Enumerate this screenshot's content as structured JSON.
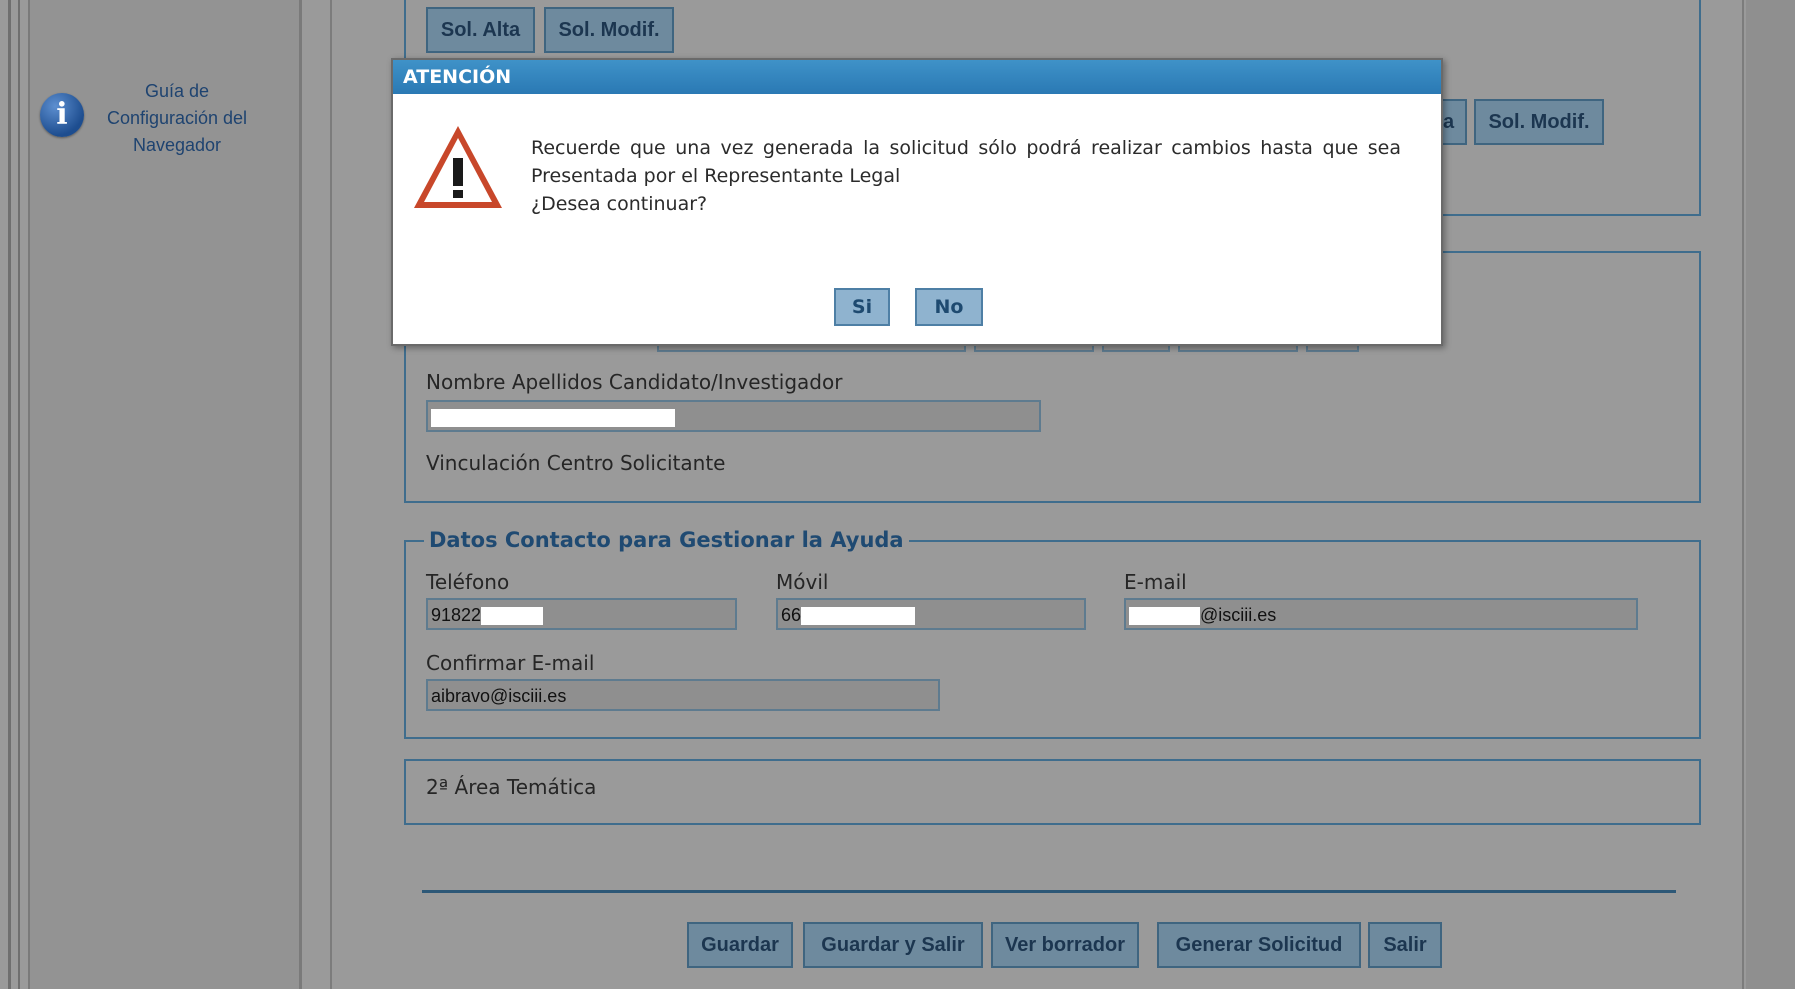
{
  "sidebar": {
    "guide_line1": "Guía de",
    "guide_line2": "Configuración del",
    "guide_line3": "Navegador"
  },
  "top_buttons": {
    "sol_alta": "Sol. Alta",
    "sol_modif": "Sol. Modif."
  },
  "behind_buttons": {
    "partial_a": "a",
    "sol_modif2": "Sol. Modif."
  },
  "candidate_section": {
    "name_label": "Nombre Apellidos Candidato/Investigador",
    "vinculacion_label": "Vinculación Centro Solicitante"
  },
  "contact_section": {
    "legend": "Datos Contacto para Gestionar la Ayuda",
    "telefono_label": "Teléfono",
    "telefono_value": "91822",
    "movil_label": "Móvil",
    "movil_value": "66",
    "email_label": "E-mail",
    "email_value": "@isciii.es",
    "confirm_email_label": "Confirmar E-mail",
    "confirm_email_value": "aibravo@isciii.es"
  },
  "area_section": {
    "label": "2ª Área Temática"
  },
  "footer_buttons": {
    "guardar": "Guardar",
    "guardar_salir": "Guardar y Salir",
    "ver_borrador": "Ver borrador",
    "generar": "Generar Solicitud",
    "salir": "Salir"
  },
  "dialog": {
    "title": "ATENCIÓN",
    "message_line1": "Recuerde que una vez generada la solicitud sólo podrá realizar cambios hasta que sea Presentada por el Representante Legal",
    "message_line2": "¿Desea continuar?",
    "yes_label": "Si",
    "no_label": "No"
  },
  "colors": {
    "accent": "#2a79b4",
    "button_bg": "#6e8a9e",
    "border": "#3f6d8d"
  }
}
